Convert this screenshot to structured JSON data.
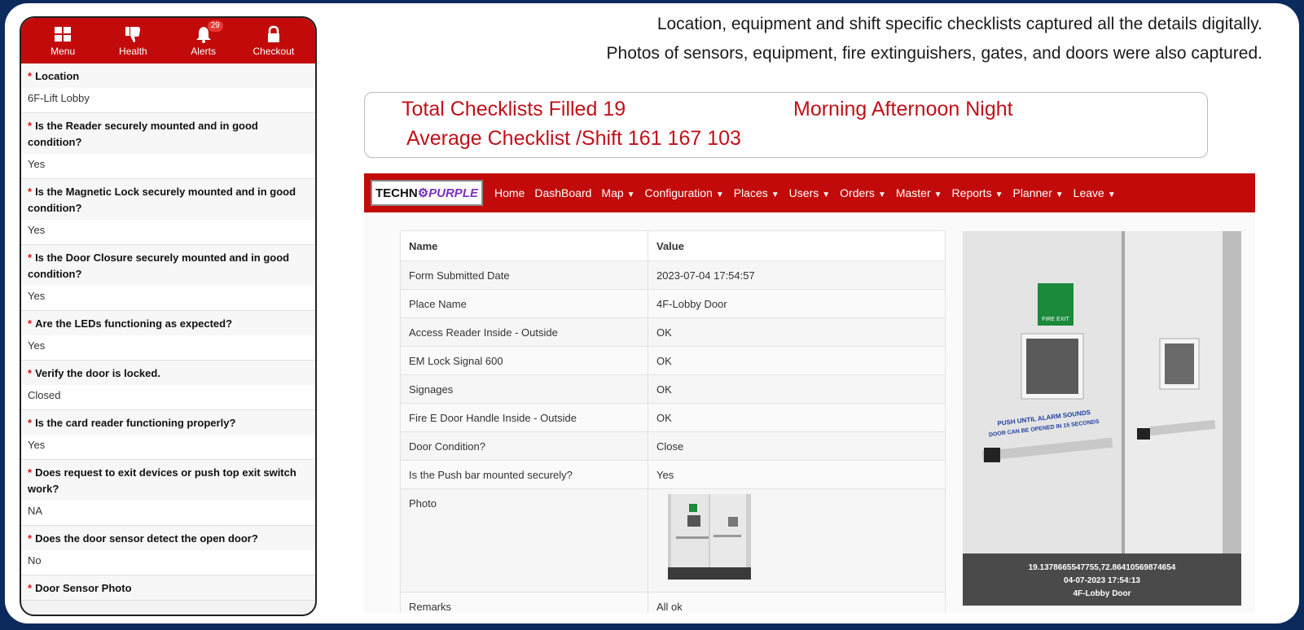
{
  "phone": {
    "nav": [
      {
        "label": "Menu",
        "icon": "grid-icon"
      },
      {
        "label": "Health",
        "icon": "thumbs-down-icon"
      },
      {
        "label": "Alerts",
        "icon": "bell-icon",
        "badge": "29"
      },
      {
        "label": "Checkout",
        "icon": "lock-icon"
      }
    ],
    "questions": [
      {
        "q": "Location",
        "a": "6F-Lift Lobby"
      },
      {
        "q": "Is the Reader securely mounted and in good condition?",
        "a": "Yes"
      },
      {
        "q": "Is the Magnetic Lock securely mounted and in good condition?",
        "a": "Yes"
      },
      {
        "q": "Is the Door Closure securely mounted and in good condition?",
        "a": "Yes"
      },
      {
        "q": "Are the LEDs functioning as expected?",
        "a": "Yes"
      },
      {
        "q": "Verify the door is locked.",
        "a": "Closed"
      },
      {
        "q": "Is the card reader functioning properly?",
        "a": "Yes"
      },
      {
        "q": "Does request to exit devices or push top exit switch work?",
        "a": "NA"
      },
      {
        "q": "Does the door sensor detect the open door?",
        "a": "No"
      },
      {
        "q": "Door Sensor Photo",
        "a": ""
      }
    ]
  },
  "caption": {
    "line1": "Location, equipment and shift specific checklists captured all the details digitally.",
    "line2": "Photos of sensors, equipment, fire extinguishers, gates, and doors were also captured."
  },
  "stats": {
    "total": "Total Checklists Filled 19",
    "shifts": "Morning Afternoon Night",
    "average": "Average Checklist /Shift 161 167 103"
  },
  "app": {
    "logo_a": "TECHN",
    "logo_b": "PURPLE",
    "menu": [
      "Home",
      "DashBoard",
      "Map",
      "Configuration",
      "Places",
      "Users",
      "Orders",
      "Master",
      "Reports",
      "Planner",
      "Leave"
    ],
    "table": {
      "headers": [
        "Name",
        "Value"
      ],
      "rows": [
        [
          "Form Submitted Date",
          "2023-07-04 17:54:57"
        ],
        [
          "Place Name",
          "4F-Lobby Door"
        ],
        [
          "Access Reader Inside - Outside",
          "OK"
        ],
        [
          "EM Lock Signal 600",
          "OK"
        ],
        [
          "Signages",
          "OK"
        ],
        [
          "Fire E Door Handle Inside - Outside",
          "OK"
        ],
        [
          "Door Condition?",
          "Close"
        ],
        [
          "Is the Push bar mounted securely?",
          "Yes"
        ],
        [
          "Photo",
          ""
        ],
        [
          "Remarks",
          "All ok"
        ]
      ]
    },
    "photo": {
      "sign": "FIRE EXIT",
      "push1": "PUSH UNTIL ALARM SOUNDS",
      "push2": "DOOR CAN BE OPENED IN 15 SECONDS",
      "gps": "19.1378665547755,72.86410569874654",
      "timestamp": "04-07-2023 17:54:13",
      "place": "4F-Lobby Door"
    }
  }
}
